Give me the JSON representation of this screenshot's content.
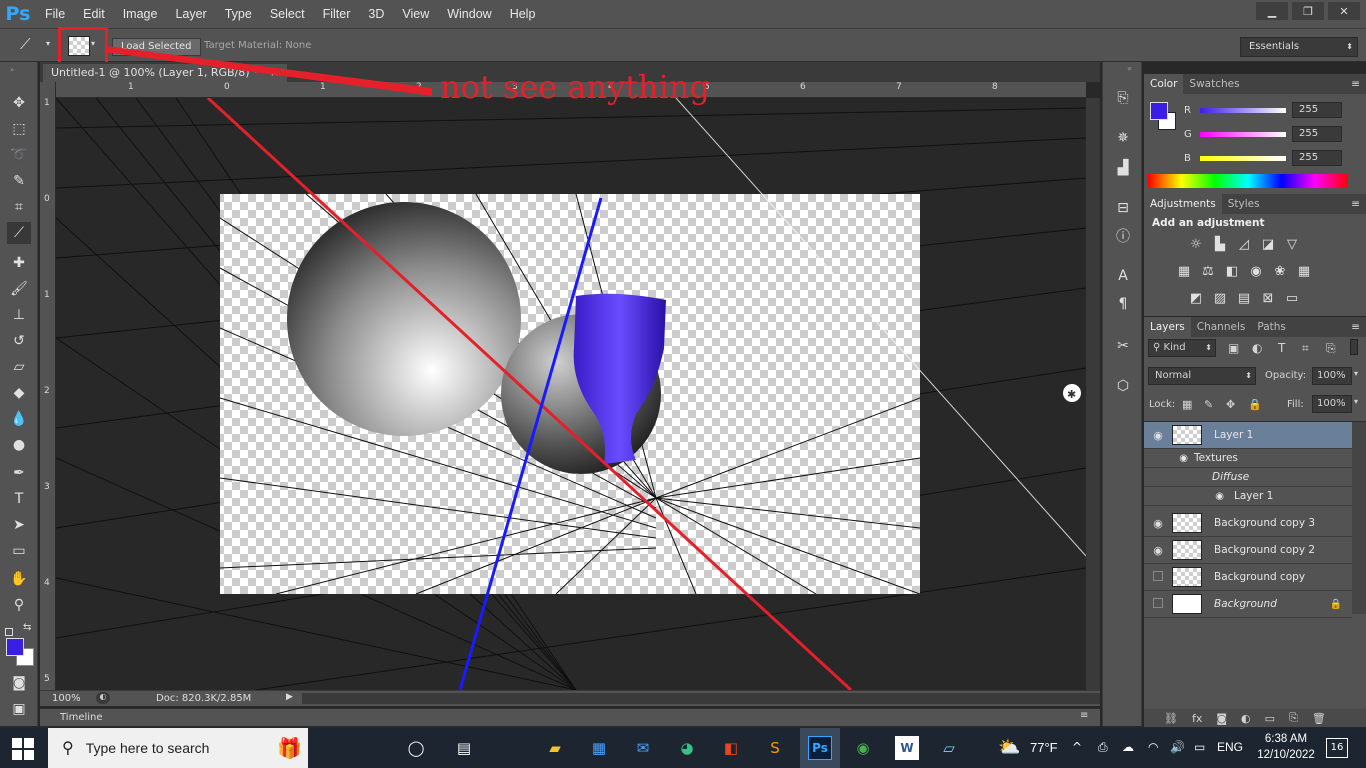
{
  "app": {
    "logo": "Ps",
    "menu": [
      "File",
      "Edit",
      "Image",
      "Layer",
      "Type",
      "Select",
      "Filter",
      "3D",
      "View",
      "Window",
      "Help"
    ],
    "window_controls": [
      "minimize-icon",
      "restore-icon",
      "close-icon"
    ]
  },
  "options_bar": {
    "load_selected_label": "Load Selected",
    "target_material": "Target Material: None",
    "workspace": "Essentials"
  },
  "document": {
    "tab_title": "Untitled-1 @ 100% (Layer 1, RGB/8) *",
    "tab_close": "×",
    "ruler_top_numbers": [
      "1",
      "0",
      "1",
      "2",
      "3",
      "4",
      "5",
      "6",
      "7",
      "8"
    ],
    "ruler_left_numbers": [
      "1",
      "0",
      "1",
      "2",
      "3",
      "4",
      "5"
    ],
    "zoom": "100%",
    "doc_size": "Doc: 820.3K/2.85M",
    "timeline_label": "Timeline"
  },
  "annotation": {
    "text": "not see anything",
    "color": "#e4202a"
  },
  "color_panel": {
    "tabs": [
      "Color",
      "Swatches"
    ],
    "r_label": "R",
    "r_value": "255",
    "g_label": "G",
    "g_value": "255",
    "b_label": "B",
    "b_value": "255",
    "foreground_color": "#3b1ee6",
    "background_color": "#ffffff"
  },
  "adjustments_panel": {
    "tabs": [
      "Adjustments",
      "Styles"
    ],
    "heading": "Add an adjustment"
  },
  "layers_panel": {
    "tabs": [
      "Layers",
      "Channels",
      "Paths"
    ],
    "filter_kind": "Kind",
    "blend_mode": "Normal",
    "opacity_label": "Opacity:",
    "opacity_value": "100%",
    "lock_label": "Lock:",
    "fill_label": "Fill:",
    "fill_value": "100%",
    "layers": [
      {
        "name": "Layer 1",
        "visible": true,
        "selected": true
      },
      {
        "name": "Textures",
        "visible": true,
        "sub": true
      },
      {
        "name": "Diffuse",
        "visible": false,
        "sub": true,
        "italic": true
      },
      {
        "name": "Layer 1",
        "visible": true,
        "sub": true
      },
      {
        "name": "Background copy 3",
        "visible": true
      },
      {
        "name": "Background copy 2",
        "visible": true
      },
      {
        "name": "Background copy",
        "visible": false
      },
      {
        "name": "Background",
        "visible": false,
        "italic": true,
        "locked": true
      }
    ]
  },
  "taskbar": {
    "search_placeholder": "Type here to search",
    "weather": "77°F",
    "language": "ENG",
    "time": "6:38 AM",
    "date": "12/10/2022",
    "notifications": "16"
  }
}
